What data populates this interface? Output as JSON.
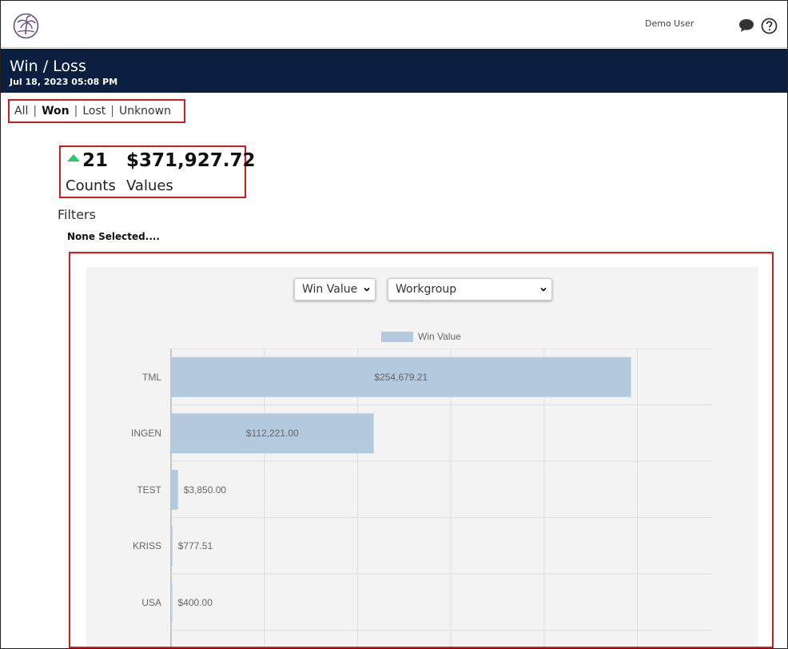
{
  "header": {
    "user_name": "Demo User",
    "logo_icon": "palm-tree-icon",
    "chat_icon": "chat-bubble-icon",
    "help_icon": "question-circle-icon"
  },
  "banner": {
    "title": "Win / Loss",
    "date": "Jul 18, 2023 05:08 PM"
  },
  "tabs": [
    {
      "label": "All",
      "active": false
    },
    {
      "label": "Won",
      "active": true
    },
    {
      "label": "Lost",
      "active": false
    },
    {
      "label": "Unknown",
      "active": false
    }
  ],
  "tab_separator": "|",
  "kpi": {
    "count": "21",
    "value": "$371,927.72",
    "count_label": "Counts",
    "value_label": "Values",
    "trend": "up"
  },
  "filters": {
    "title": "Filters",
    "value": "None Selected...."
  },
  "controls": {
    "metric_selected": "Win Value",
    "group_selected": "Workgroup"
  },
  "colors": {
    "banner": "#0b1f40",
    "bar": "#b3c9de",
    "trend_up": "#2bc56a",
    "highlight_border": "#d61c1c"
  },
  "chart_data": {
    "type": "bar",
    "orientation": "horizontal",
    "legend": [
      "Win Value"
    ],
    "legend_position": "top",
    "grid": true,
    "xlim": [
      0,
      300000
    ],
    "categories": [
      "TML",
      "INGEN",
      "TEST",
      "KRISS",
      "USA"
    ],
    "series": [
      {
        "name": "Win Value",
        "values": [
          254679.21,
          112221.0,
          3850.0,
          777.51,
          400.0
        ],
        "labels": [
          "$254,679.21",
          "$112,221.00",
          "$3,850.00",
          "$777.51",
          "$400.00"
        ]
      }
    ]
  }
}
